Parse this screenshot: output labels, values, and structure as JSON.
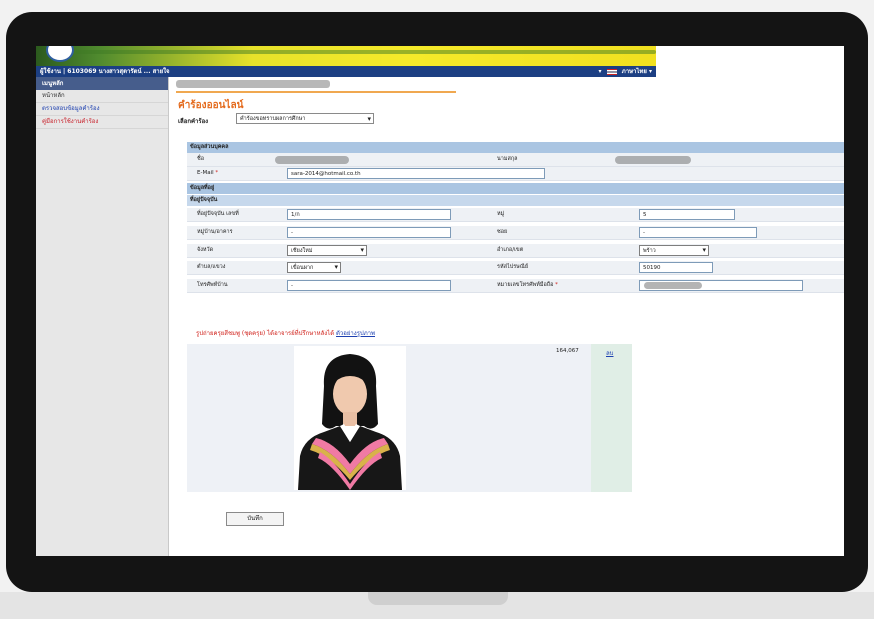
{
  "header": {
    "user_info": "ผู้ใช้งาน | 6103069 นางสาวสุดารัตน์ ... สายใจ",
    "language": "ภาษาไทย"
  },
  "sidebar": {
    "title": "เมนูหลัก",
    "items": [
      {
        "label": "หน้าหลัก",
        "color": "#333333"
      },
      {
        "label": "ตรวจสอบข้อมูลคำร้อง",
        "color": "#1c3fb0"
      },
      {
        "label": "คู่มือการใช้งานคำร้อง",
        "color": "#c8202a"
      }
    ]
  },
  "page": {
    "title": "คำร้องออนไลน์",
    "select_label": "เลือกคำร้อง",
    "select_value": "คำร้องขอทราบผลการศึกษา"
  },
  "sections": {
    "personal": "ข้อมูลส่วนบุคคล",
    "address": "ข้อมูลที่อยู่",
    "current_address": "ที่อยู่ปัจจุบัน"
  },
  "fields": {
    "name_label": "ชื่อ",
    "surname_label": "นามสกุล",
    "email_label": "E-Mail",
    "email_required": "*",
    "email_value": "sara-2014@hotmail.co.th",
    "house_label": "ที่อยู่ปัจจุบัน เลขที่",
    "house_value": "1/ก",
    "moo_label": "หมู่",
    "moo_value": "5",
    "village_label": "หมู่บ้าน/อาคาร",
    "village_value": "-",
    "soi_label": "ซอย",
    "soi_value": "-",
    "province_label": "จังหวัด",
    "province_value": "เชียงใหม่",
    "district_label": "อำเภอ/เขต",
    "district_value": "พร้าว",
    "subdistrict_label": "ตำบล/แขวง",
    "subdistrict_value": "เขื่อนผาก",
    "postal_label": "รหัสไปรษณีย์",
    "postal_value": "50190",
    "homephone_label": "โทรศัพท์บ้าน",
    "homephone_value": "-",
    "mobile_label": "หมายเลขโทรศัพท์มือถือ",
    "mobile_required": "*"
  },
  "photo": {
    "notice": "รูปถ่ายครุยสีชมพู (ชุดครุย) ได้อาจารย์ที่ปรึกษาหลังได้",
    "notice_link": "ตัวอย่างรูปภาพ",
    "size": "164,067",
    "delete": "ลบ"
  },
  "buttons": {
    "save": "บันทึก"
  },
  "colors": {
    "accent_orange": "#e46a1c",
    "section_blue": "#aac5e2",
    "topbar_navy": "#1c3f83",
    "required_red": "#d0201a",
    "link_blue": "#1c3fb0"
  }
}
